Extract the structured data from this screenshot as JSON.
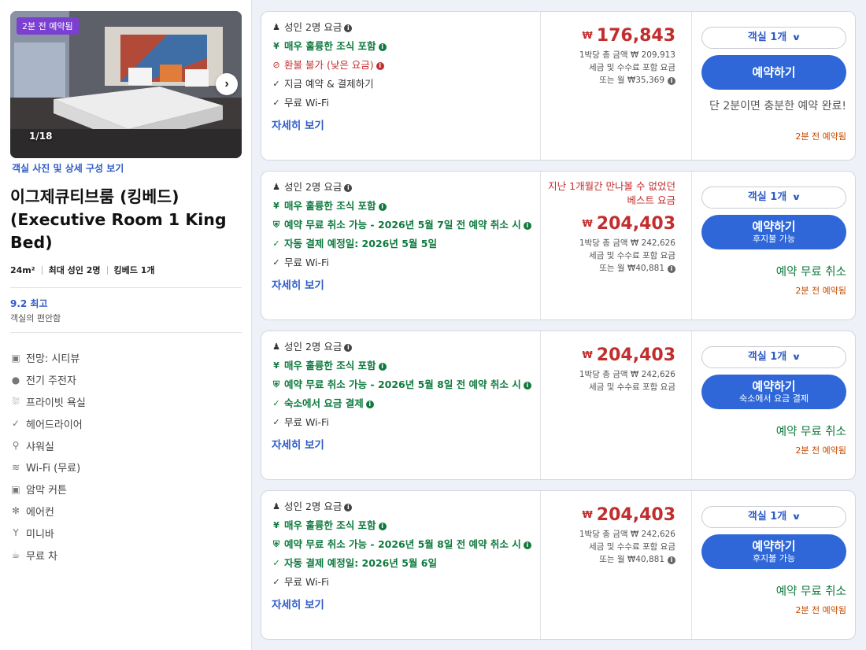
{
  "room": {
    "badge": "2분 전 예약됨",
    "photo_counter": "1/18",
    "photo_link": "객실 사진 및 상세 구성 보기",
    "title": "이그제큐티브룸 (킹베드) (Executive Room 1 King Bed)",
    "size": "24m²",
    "occupancy": "최대 성인 2명",
    "bed": "킹베드 1개",
    "score": "9.2 최고",
    "score_sub": "객실의 편안함",
    "amenities": [
      {
        "icon": "view-icon",
        "label": "전망: 시티뷰"
      },
      {
        "icon": "charger-icon",
        "label": "전기 주전자"
      },
      {
        "icon": "bathtub-icon",
        "label": "프라이빗 욕실"
      },
      {
        "icon": "hairdryer-icon",
        "label": "헤어드라이어"
      },
      {
        "icon": "shower-icon",
        "label": "샤워실"
      },
      {
        "icon": "wifi-icon",
        "label": "Wi-Fi (무료)"
      },
      {
        "icon": "curtain-icon",
        "label": "암막 커튼"
      },
      {
        "icon": "aircon-icon",
        "label": "에어컨"
      },
      {
        "icon": "minibar-icon",
        "label": "미니바"
      },
      {
        "icon": "tea-icon",
        "label": "무료 차"
      }
    ]
  },
  "offers": [
    {
      "occupancy": "성인 2명 요금",
      "features": [
        {
          "type": "green",
          "icon": "meal-icon",
          "text": "매우 훌륭한 조식 포함",
          "info": true
        },
        {
          "type": "red",
          "icon": "no-refund-icon",
          "text": "환불 불가 (낮은 요금)",
          "info": true
        },
        {
          "type": "plain",
          "icon": "check-icon",
          "text": "지금 예약 & 결제하기",
          "info": false
        },
        {
          "type": "plain",
          "icon": "check-icon",
          "text": "무료 Wi-Fi",
          "info": false
        }
      ],
      "detail": "자세히 보기",
      "best_note": "",
      "currency": "₩",
      "price": "176,843",
      "price_lines": [
        "1박당 총 금액 ₩ 209,913",
        "세금 및 수수료 포함 요금",
        "또는 월 ₩35,369"
      ],
      "rooms": "객실 1개",
      "book": "예약하기",
      "book_sub": "",
      "free_cancel": "",
      "urgency": "단 2분이면 충분한 예약 완료!",
      "booked": "2분 전 예약됨"
    },
    {
      "occupancy": "성인 2명 요금",
      "features": [
        {
          "type": "green",
          "icon": "meal-icon",
          "text": "매우 훌륭한 조식 포함",
          "info": true
        },
        {
          "type": "green",
          "icon": "shield-icon",
          "text": "예약 무료 취소 가능 - 2026년 5월 7일 전 예약 취소 시",
          "info": true
        },
        {
          "type": "green",
          "icon": "check-icon",
          "text": "자동 결제 예정일: 2026년 5월 5일",
          "info": false
        },
        {
          "type": "plain",
          "icon": "check-icon",
          "text": "무료 Wi-Fi",
          "info": false
        }
      ],
      "detail": "자세히 보기",
      "best_note": "지난 1개월간 만나볼 수 없었던 베스트 요금",
      "currency": "₩",
      "price": "204,403",
      "price_lines": [
        "1박당 총 금액 ₩ 242,626",
        "세금 및 수수료 포함 요금",
        "또는 월 ₩40,881"
      ],
      "rooms": "객실 1개",
      "book": "예약하기",
      "book_sub": "후지불 가능",
      "free_cancel": "예약 무료 취소",
      "urgency": "",
      "booked": "2분 전 예약됨"
    },
    {
      "occupancy": "성인 2명 요금",
      "features": [
        {
          "type": "green",
          "icon": "meal-icon",
          "text": "매우 훌륭한 조식 포함",
          "info": true
        },
        {
          "type": "green",
          "icon": "shield-icon",
          "text": "예약 무료 취소 가능 - 2026년 5월 8일 전 예약 취소 시",
          "info": true
        },
        {
          "type": "green",
          "icon": "check-icon",
          "text": "숙소에서 요금 결제",
          "info": true
        },
        {
          "type": "plain",
          "icon": "check-icon",
          "text": "무료 Wi-Fi",
          "info": false
        }
      ],
      "detail": "자세히 보기",
      "best_note": "",
      "currency": "₩",
      "price": "204,403",
      "price_lines": [
        "1박당 총 금액 ₩ 242,626",
        "세금 및 수수료 포함 요금"
      ],
      "rooms": "객실 1개",
      "book": "예약하기",
      "book_sub": "숙소에서 요금 결제",
      "free_cancel": "예약 무료 취소",
      "urgency": "",
      "booked": "2분 전 예약됨"
    },
    {
      "occupancy": "성인 2명 요금",
      "features": [
        {
          "type": "green",
          "icon": "meal-icon",
          "text": "매우 훌륭한 조식 포함",
          "info": true
        },
        {
          "type": "green",
          "icon": "shield-icon",
          "text": "예약 무료 취소 가능 - 2026년 5월 8일 전 예약 취소 시",
          "info": true
        },
        {
          "type": "green",
          "icon": "check-icon",
          "text": "자동 결제 예정일: 2026년 5월 6일",
          "info": false
        },
        {
          "type": "plain",
          "icon": "check-icon",
          "text": "무료 Wi-Fi",
          "info": false
        }
      ],
      "detail": "자세히 보기",
      "best_note": "",
      "currency": "₩",
      "price": "204,403",
      "price_lines": [
        "1박당 총 금액 ₩ 242,626",
        "세금 및 수수료 포함 요금",
        "또는 월 ₩40,881"
      ],
      "rooms": "객실 1개",
      "book": "예약하기",
      "book_sub": "후지불 가능",
      "free_cancel": "예약 무료 취소",
      "urgency": "",
      "booked": "2분 전 예약됨"
    }
  ]
}
